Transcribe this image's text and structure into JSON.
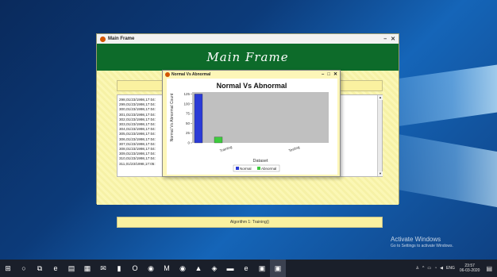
{
  "main_frame": {
    "title": "Main Frame",
    "header": "Main Frame",
    "minimize_glyph": "–",
    "close_glyph": "✕",
    "log_lines": [
      "298,01/23/1998,17:04:",
      "299,01/23/1998,17:04:",
      "300,01/23/1998,17:04:",
      "301,01/23/1998,17:04:",
      "302,01/23/1998,17:04:",
      "303,01/23/1998,17:04:",
      "304,01/23/1998,17:04:",
      "305,01/23/1998,17:04:",
      "306,01/23/1998,17:04:",
      "307,01/23/1998,17:04:",
      "308,01/23/1998,17:04:",
      "309,01/23/1998,17:04:",
      "310,01/23/1998,17:04:",
      "311,01/23/1998,17:05:"
    ],
    "status_text": "Algorithm 1: Training()"
  },
  "chart_dialog": {
    "title": "Normal Vs Abnormal",
    "minimize_glyph": "–",
    "maximize_glyph": "□",
    "close_glyph": "✕"
  },
  "chart_data": {
    "type": "bar",
    "title": "Normal Vs Abnormal",
    "xlabel": "Dataset",
    "ylabel": "Normal Vs Abnormal Count",
    "categories": [
      "Training",
      "Testing"
    ],
    "series": [
      {
        "name": "Normal",
        "values": [
          125,
          0
        ],
        "color": "#2b3bd6"
      },
      {
        "name": "Abnormal",
        "values": [
          15,
          0
        ],
        "color": "#3ecb3e"
      }
    ],
    "yticks": [
      0,
      25,
      50,
      75,
      100,
      125
    ],
    "ylim": [
      0,
      130
    ],
    "legend": "bottom",
    "plot_background": "#c0c0c0",
    "grid": false
  },
  "watermark": {
    "line1": "Activate Windows",
    "line2": "Go to Settings to activate Windows."
  },
  "taskbar": {
    "icons": [
      "windows-start-icon",
      "search-icon",
      "task-view-icon",
      "edge-icon",
      "store-icon",
      "photos-icon",
      "mail-icon",
      "files-icon",
      "opera-icon",
      "chrome-icon",
      "mcafee-icon",
      "chrome-icon-2",
      "paint-icon",
      "vm-icon",
      "media-icon",
      "edge-icon-2",
      "app-icon",
      "java-app-icon"
    ],
    "glyphs": [
      "⊞",
      "○",
      "⧉",
      "e",
      "▤",
      "▦",
      "✉",
      "▮",
      "O",
      "◉",
      "M",
      "◉",
      "▲",
      "◈",
      "▬",
      "e",
      "▣",
      "▣"
    ],
    "tray_text": "ENG",
    "time": "23:57",
    "date": "06-03-2020"
  },
  "colors": {
    "header_green": "#0d6b2a",
    "panel_yellow": "#fdfbc4",
    "normal_bar": "#2b3bd6",
    "abnormal_bar": "#3ecb3e"
  }
}
